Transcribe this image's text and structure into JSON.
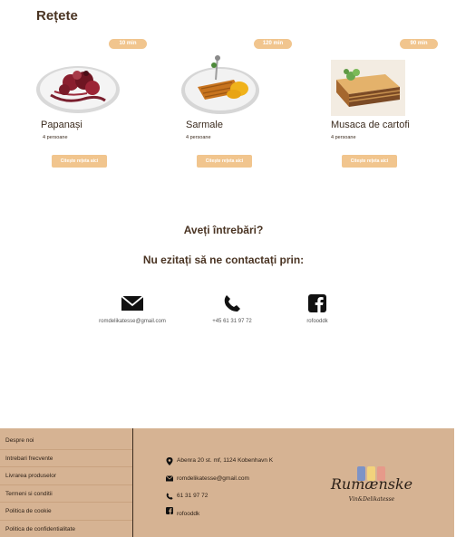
{
  "page": {
    "title": "Rețete"
  },
  "recipes": [
    {
      "time": "10 min",
      "name": "Papanași",
      "servings": "4 persoane",
      "button": "Citește rețeta aici",
      "image": "papanasi-dish"
    },
    {
      "time": "120 min",
      "name": "Sarmale",
      "servings": "4 persoane",
      "button": "Citește rețeta aici",
      "image": "sarmale-dish"
    },
    {
      "time": "90 min",
      "name": "Musaca de cartofi",
      "servings": "4 persoane",
      "button": "Citește rețeta aici",
      "image": "musaca-dish"
    }
  ],
  "questions": {
    "title": "Aveți întrebări?",
    "subtitle": "Nu ezitați să ne contactați prin:"
  },
  "contact": [
    {
      "icon": "envelope-icon",
      "text": "romdelikatesse@gmail.com"
    },
    {
      "icon": "phone-icon",
      "text": "+45 61 31 97 72"
    },
    {
      "icon": "facebook-icon",
      "text": "rofooddk"
    }
  ],
  "footer": {
    "links": [
      "Despre noi",
      "Intrebari frecvente",
      "Livrarea produselor",
      "Termeni si conditii",
      "Politica de cookie",
      "Politica de confidentialitate"
    ],
    "info": [
      {
        "icon": "location-pin-icon",
        "text": "Abenra 20 st. mf, 1124 Kobenhavn K"
      },
      {
        "icon": "envelope-icon",
        "text": "romdelikatesse@gmail.com"
      },
      {
        "icon": "phone-icon",
        "text": "61 31 97 72"
      },
      {
        "icon": "facebook-icon",
        "text": "rofooddk"
      }
    ],
    "logo": {
      "name": "Rumænske",
      "tagline": "Vin&Delikatesse"
    }
  },
  "colors": {
    "accent": "#f1c58e",
    "footer_bg": "#d6b393",
    "text_dark": "#3b2b1e",
    "flag_blue": "#7d93c6",
    "flag_yellow": "#f2d27c",
    "flag_red": "#e69a8a"
  }
}
